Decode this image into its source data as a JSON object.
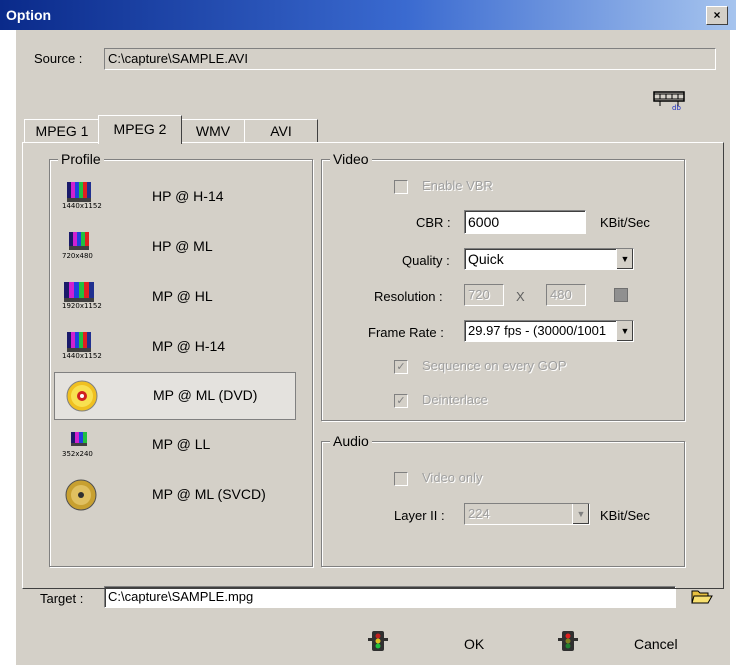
{
  "window": {
    "title": "Option",
    "close": "×"
  },
  "source": {
    "label": "Source :",
    "value": "C:\\capture\\SAMPLE.AVI"
  },
  "tabs": [
    {
      "label": "MPEG 1",
      "active": false
    },
    {
      "label": "MPEG 2",
      "active": true
    },
    {
      "label": "WMV",
      "active": false
    },
    {
      "label": "AVI",
      "active": false
    }
  ],
  "profile": {
    "group_label": "Profile",
    "items": [
      {
        "label": "HP @ H-14",
        "res": "1440x1152",
        "icon": "color-bars-icon"
      },
      {
        "label": "HP @ ML",
        "res": "720x480",
        "icon": "color-bars-icon"
      },
      {
        "label": "MP @ HL",
        "res": "1920x1152",
        "icon": "color-bars-icon"
      },
      {
        "label": "MP @ H-14",
        "res": "1440x1152",
        "icon": "color-bars-icon"
      },
      {
        "label": "MP @ ML (DVD)",
        "res": "",
        "icon": "dvd-disc-icon",
        "selected": true
      },
      {
        "label": "MP @ LL",
        "res": "352x240",
        "icon": "color-bars-icon"
      },
      {
        "label": "MP @ ML (SVCD)",
        "res": "",
        "icon": "svcd-disc-icon"
      }
    ]
  },
  "video": {
    "group_label": "Video",
    "enable_vbr": "Enable VBR",
    "cbr_label": "CBR :",
    "cbr_value": "6000",
    "cbr_unit": "KBit/Sec",
    "quality_label": "Quality :",
    "quality_value": "Quick",
    "resolution_label": "Resolution :",
    "res_w": "720",
    "res_x": "X",
    "res_h": "480",
    "frame_rate_label": "Frame Rate :",
    "frame_rate_value": "29.97 fps - (30000/1001",
    "sequence_gop": "Sequence on every GOP",
    "deinterlace": "Deinterlace"
  },
  "audio": {
    "group_label": "Audio",
    "video_only": "Video only",
    "layer_label": "Layer II :",
    "layer_value": "224",
    "layer_unit": "KBit/Sec"
  },
  "target": {
    "label": "Target :",
    "value": "C:\\capture\\SAMPLE.mpg"
  },
  "buttons": {
    "ok": "OK",
    "cancel": "Cancel"
  },
  "colors": {
    "title_start": "#0a2a8a",
    "face": "#d4d0c8"
  }
}
